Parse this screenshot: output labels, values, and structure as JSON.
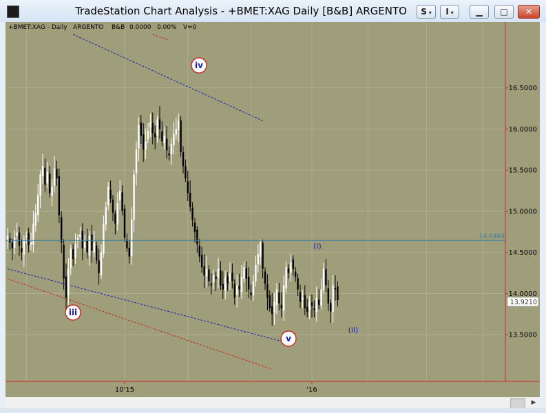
{
  "window": {
    "title": "TradeStation Chart Analysis - +BMET:XAG Daily [B&B] ARGENTO",
    "buttons": {
      "symbol_menu": "S",
      "indicator_menu": "I"
    }
  },
  "header_line": {
    "symbol": "+BMET:XAG - Daily",
    "name": "ARGENTO",
    "study": "B&B",
    "change": "0.0000",
    "change_pct": "0.00%",
    "volume": "V=0"
  },
  "colors": {
    "plot_bg": "#9e9e7a",
    "axis_line": "#cc2a2a",
    "grid": "#b6b698",
    "up_bar": "#ffffff",
    "down_bar": "#000000",
    "hline": "#3a7ea6",
    "upper_channel": "#1a1ab8",
    "lower_channel": "#d42020",
    "wave_circle_border": "#cc1010",
    "wave_text_primary": "#1a1ab8",
    "wave_text_minor": "#1a1ab8"
  },
  "chart_data": {
    "type": "ohlc",
    "symbol": "+BMET:XAG",
    "interval": "Daily",
    "ylim": [
      13.0,
      17.15
    ],
    "y_ticks": [
      "16.5000",
      "16.0000",
      "15.5000",
      "15.0000",
      "14.5000",
      "14.0000",
      "13.5000"
    ],
    "x_ticks": [
      "10'15",
      "'16"
    ],
    "last_price": "13.9210",
    "horizontal_line": {
      "value": "14.6464"
    },
    "anchors": {
      "bar_sep_2015": 0,
      "bar_oct_2015": 50,
      "bar_jan_2016": 130
    },
    "closes": [
      14.7,
      14.62,
      14.55,
      14.68,
      14.74,
      14.58,
      14.5,
      14.66,
      14.7,
      14.59,
      14.62,
      14.85,
      14.98,
      15.2,
      15.45,
      15.55,
      15.32,
      15.48,
      15.22,
      15.3,
      15.52,
      15.4,
      14.95,
      14.62,
      14.18,
      13.95,
      14.3,
      14.55,
      14.42,
      14.6,
      14.68,
      14.72,
      14.55,
      14.62,
      14.5,
      14.7,
      14.52,
      14.62,
      14.4,
      14.25,
      14.5,
      14.85,
      15.05,
      15.3,
      15.15,
      14.98,
      14.85,
      15.1,
      15.25,
      15.0,
      14.68,
      14.55,
      14.45,
      14.9,
      15.45,
      15.75,
      16.05,
      15.92,
      15.75,
      15.85,
      15.98,
      16.08,
      15.95,
      15.9,
      16.12,
      16.0,
      15.85,
      15.92,
      15.74,
      15.68,
      15.82,
      15.94,
      16.0,
      16.1,
      15.72,
      15.55,
      15.4,
      15.22,
      15.05,
      14.9,
      14.75,
      14.6,
      14.45,
      14.32,
      14.22,
      14.3,
      14.15,
      14.1,
      14.22,
      14.18,
      14.3,
      14.1,
      14.05,
      14.2,
      14.12,
      14.25,
      14.15,
      13.95,
      14.1,
      14.05,
      14.2,
      14.32,
      14.18,
      14.05,
      13.98,
      14.15,
      14.35,
      14.48,
      14.62,
      14.3,
      14.12,
      13.95,
      13.82,
      13.75,
      13.9,
      14.05,
      13.88,
      13.82,
      14.1,
      14.32,
      14.25,
      14.38,
      14.3,
      14.2,
      14.05,
      13.9,
      13.95,
      13.82,
      13.78,
      13.9,
      13.85,
      13.8,
      13.95,
      13.86,
      14.05,
      14.3,
      14.1,
      13.88,
      13.78,
      14.1,
      14.05,
      13.92
    ]
  },
  "annotations": {
    "wave_iv": "iv",
    "wave_iii": "iii",
    "wave_v": "v",
    "wave_i_minor": "(i)",
    "wave_ii_minor": "(ii)"
  }
}
